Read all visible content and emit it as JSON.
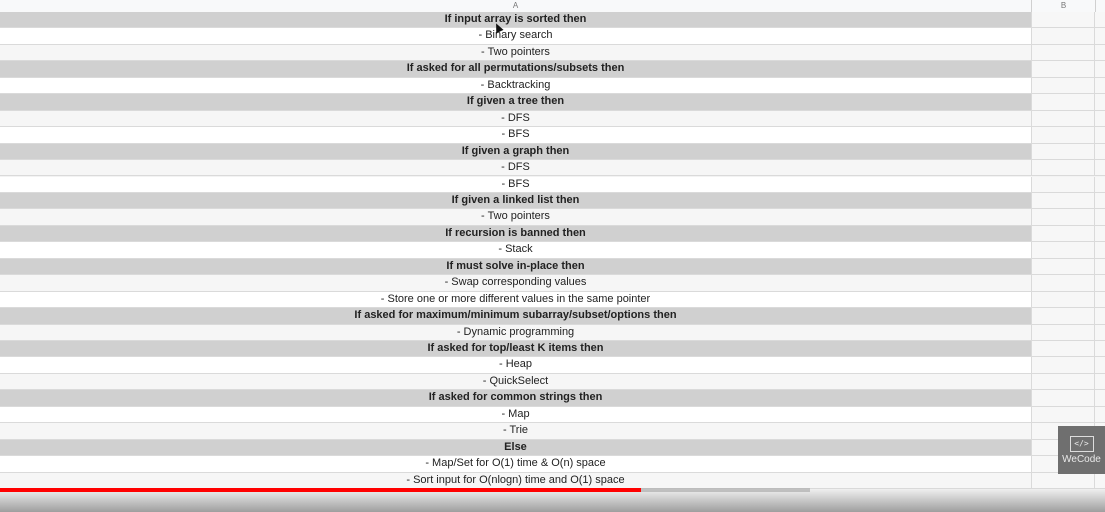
{
  "sheet": {
    "columns": [
      "A",
      "B"
    ],
    "rows": [
      {
        "type": "header",
        "text": "If input array is sorted then"
      },
      {
        "type": "item",
        "text": "- Binary search"
      },
      {
        "type": "item",
        "text": "- Two pointers"
      },
      {
        "type": "header",
        "text": "If asked for all permutations/subsets then"
      },
      {
        "type": "item",
        "text": "- Backtracking"
      },
      {
        "type": "header",
        "text": "If given a tree then"
      },
      {
        "type": "item",
        "text": "- DFS"
      },
      {
        "type": "item",
        "text": "- BFS"
      },
      {
        "type": "header",
        "text": "If given a graph then"
      },
      {
        "type": "item",
        "text": "- DFS"
      },
      {
        "type": "item",
        "text": "- BFS"
      },
      {
        "type": "header",
        "text": "If given a linked list then"
      },
      {
        "type": "item",
        "text": "- Two pointers"
      },
      {
        "type": "header",
        "text": "If recursion is banned then"
      },
      {
        "type": "item",
        "text": "- Stack"
      },
      {
        "type": "header",
        "text": "If must solve in-place then"
      },
      {
        "type": "item",
        "text": "- Swap corresponding values"
      },
      {
        "type": "item",
        "text": "- Store one or more different values in the same pointer"
      },
      {
        "type": "header",
        "text": "If asked for maximum/minimum subarray/subset/options then"
      },
      {
        "type": "item",
        "text": "- Dynamic programming"
      },
      {
        "type": "header",
        "text": "If asked for top/least K items then"
      },
      {
        "type": "item",
        "text": "- Heap"
      },
      {
        "type": "item",
        "text": "- QuickSelect"
      },
      {
        "type": "header",
        "text": "If asked for common strings then"
      },
      {
        "type": "item",
        "text": "- Map"
      },
      {
        "type": "item",
        "text": "- Trie"
      },
      {
        "type": "header",
        "text": "Else"
      },
      {
        "type": "item",
        "text": "- Map/Set for O(1) time & O(n) space"
      },
      {
        "type": "item",
        "text": "- Sort input for O(nlogn) time and O(1) space"
      }
    ]
  },
  "video": {
    "progress": 0.58,
    "buffered": 0.733,
    "progress_color": "#ff0000"
  },
  "watermark": {
    "label": "WeCode",
    "icon": "code-icon",
    "icon_glyph": "</>"
  }
}
